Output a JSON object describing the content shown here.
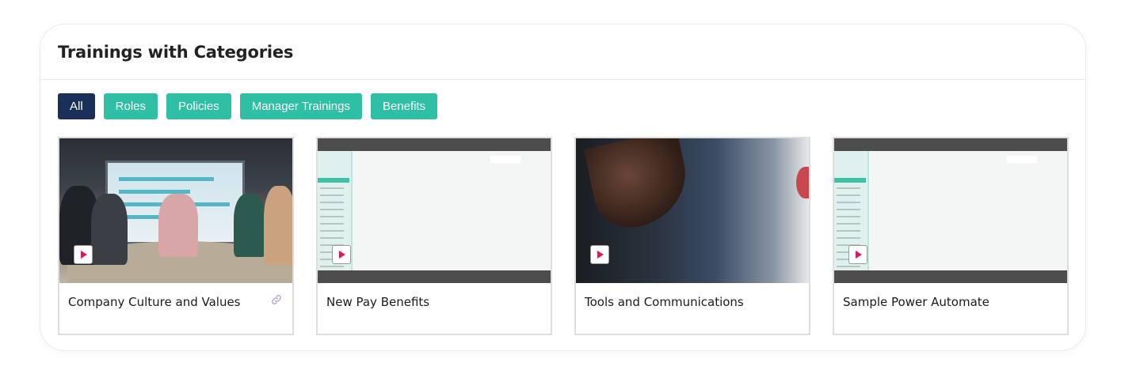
{
  "section": {
    "title": "Trainings with Categories"
  },
  "filters": [
    {
      "label": "All",
      "active": true
    },
    {
      "label": "Roles",
      "active": false
    },
    {
      "label": "Policies",
      "active": false
    },
    {
      "label": "Manager Trainings",
      "active": false
    },
    {
      "label": "Benefits",
      "active": false
    }
  ],
  "cards": [
    {
      "title": "Company Culture and Values",
      "thumbnail": "meeting-photo",
      "has_link_icon": true
    },
    {
      "title": "New Pay Benefits",
      "thumbnail": "app-screenshot",
      "has_link_icon": false
    },
    {
      "title": "Tools and Communications",
      "thumbnail": "handshake-photo",
      "has_link_icon": false
    },
    {
      "title": "Sample Power Automate",
      "thumbnail": "app-screenshot",
      "has_link_icon": false
    }
  ],
  "colors": {
    "active_chip": "#1b2f5b",
    "chip": "#2ebfa5",
    "play_icon": "#d81b60",
    "link_icon": "#b9a7d6"
  }
}
